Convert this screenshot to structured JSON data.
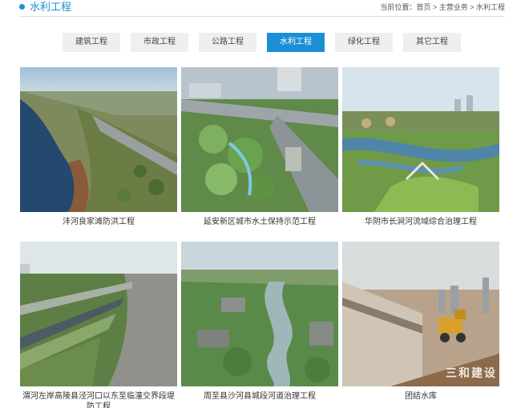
{
  "header": {
    "title": "水利工程",
    "breadcrumb": {
      "prefix": "当前位置：",
      "home": "首页",
      "sep1": " > ",
      "section": "主营业务",
      "sep2": " > ",
      "current": "水利工程"
    }
  },
  "tabs": [
    {
      "label": "建筑工程",
      "active": false
    },
    {
      "label": "市政工程",
      "active": false
    },
    {
      "label": "公路工程",
      "active": false
    },
    {
      "label": "水利工程",
      "active": true
    },
    {
      "label": "绿化工程",
      "active": false
    },
    {
      "label": "其它工程",
      "active": false
    }
  ],
  "projects": [
    {
      "caption": "沣河良家滩防洪工程"
    },
    {
      "caption": "延安新区城市水土保持示范工程"
    },
    {
      "caption": "华阴市长涧河流域综合治理工程"
    },
    {
      "caption": "渭河左岸高陵县泾河口以东至临潼交界段堤防工程"
    },
    {
      "caption": "周至县沙河县城段河道治理工程"
    },
    {
      "caption": "团结水库"
    }
  ],
  "watermark": "三和建设",
  "colors": {
    "accent": "#1a8fd6",
    "tab_bg": "#efefef"
  }
}
